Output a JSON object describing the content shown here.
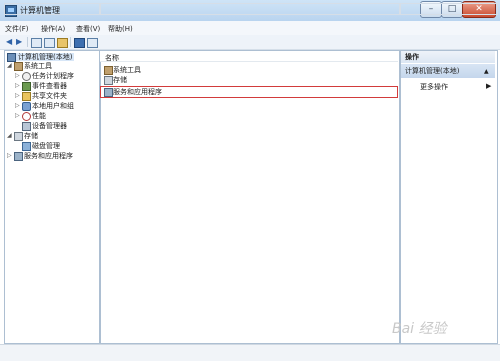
{
  "window": {
    "title": "计算机管理"
  },
  "menu": [
    "文件(F)",
    "操作(A)",
    "查看(V)",
    "帮助(H)"
  ],
  "tree": {
    "root": "计算机管理(本地)",
    "system_tools": "系统工具",
    "task_scheduler": "任务计划程序",
    "event_viewer": "事件查看器",
    "shared_folders": "共享文件夹",
    "local_users": "本地用户和组",
    "performance": "性能",
    "device_manager": "设备管理器",
    "storage": "存储",
    "disk_management": "磁盘管理",
    "services_apps": "服务和应用程序"
  },
  "list": {
    "header": "名称",
    "items": [
      "系统工具",
      "存储",
      "服务和应用程序"
    ]
  },
  "actions": {
    "title": "操作",
    "section": "计算机管理(本地)",
    "more": "更多操作"
  },
  "watermark": "Bai 经验"
}
